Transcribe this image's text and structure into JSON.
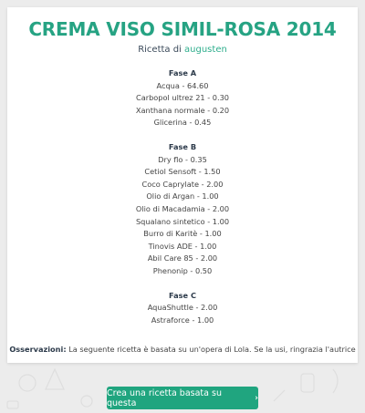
{
  "title": "CREMA VISO SIMIL-ROSA 2014",
  "byline": {
    "prefix": "Ricetta di",
    "author": "augusten"
  },
  "phases": [
    {
      "name": "Fase A",
      "items": [
        "Acqua - 64.60",
        "Carbopol ultrez 21 - 0.30",
        "Xanthana normale - 0.20",
        "Glicerina - 0.45"
      ]
    },
    {
      "name": "Fase B",
      "items": [
        "Dry flo - 0.35",
        "Cetiol Sensoft - 1.50",
        "Coco Caprylate - 2.00",
        "Olio di Argan - 1.00",
        "Olio di Macadamia - 2.00",
        "Squalano sintetico - 1.00",
        "Burro di Karitè - 1.00",
        "Tinovis ADE - 1.00",
        "Abil Care 85 - 2.00",
        "Phenonip - 0.50"
      ]
    },
    {
      "name": "Fase C",
      "items": [
        "AquaShuttle - 2.00",
        "Astraforce - 1.00"
      ]
    }
  ],
  "notes": {
    "label": "Osservazioni:",
    "text": "La seguente ricetta è basata su un'opera di Lola. Se la usi, ringrazia l'autrice"
  },
  "cta": {
    "label": "Crea una ricetta basata su questa",
    "icon": "chevron-right-icon"
  },
  "colors": {
    "accent": "#26a383",
    "button": "#20a57f",
    "background": "#ececec"
  }
}
